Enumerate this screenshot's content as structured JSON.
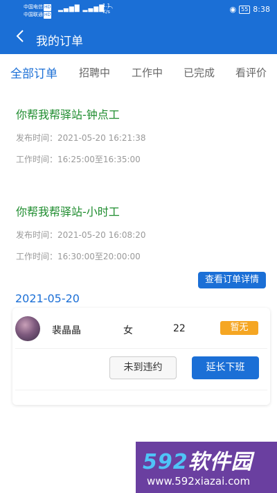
{
  "status_bar": {
    "carrier_1": "中国电信",
    "carrier_2": "中国联通",
    "hd": "HD",
    "signal_label": "4G 46",
    "speed_value": "1.1",
    "speed_unit": "K/s",
    "battery": "55",
    "time": "8:38"
  },
  "header": {
    "title": "我的订单"
  },
  "tabs": [
    {
      "label": "全部订单",
      "active": true
    },
    {
      "label": "招聘中",
      "active": false
    },
    {
      "label": "工作中",
      "active": false
    },
    {
      "label": "已完成",
      "active": false
    },
    {
      "label": "看评价",
      "active": false
    }
  ],
  "orders": [
    {
      "title": "你帮我帮驿站-钟点工",
      "publish_label": "发布时间：",
      "publish_time": "2021-05-20 16:21:38",
      "work_label": "工作时间：",
      "work_time": "16:25:00至16:35:00"
    },
    {
      "title": "你帮我帮驿站-小时工",
      "publish_label": "发布时间：",
      "publish_time": "2021-05-20 16:08:20",
      "work_label": "工作时间：",
      "work_time": "16:30:00至20:00:00",
      "detail_button": "查看订单详情",
      "date": "2021-05-20",
      "worker": {
        "name": "裴晶晶",
        "gender": "女",
        "age": "22",
        "status": "暂无",
        "absent_button": "未到违约",
        "extend_button": "延长下班"
      }
    }
  ],
  "watermark": {
    "logo_num": "592",
    "logo_text": "软件园",
    "url": "www.592xiazai.com"
  },
  "colors": {
    "primary": "#1b6fd6",
    "title_green": "#1e8c2e",
    "badge_orange": "#f5a623"
  }
}
